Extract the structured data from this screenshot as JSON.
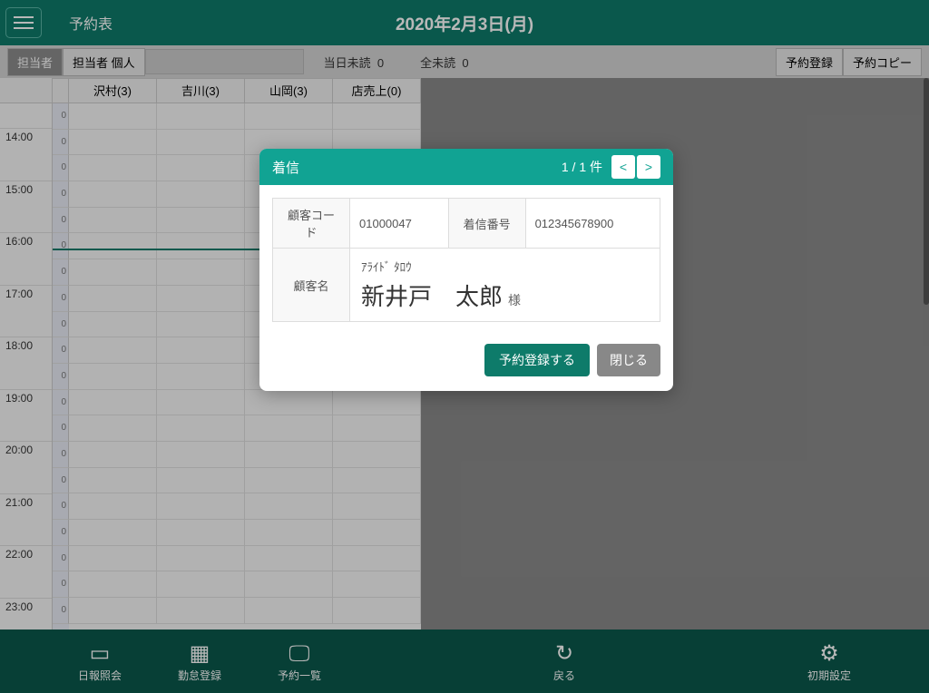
{
  "header": {
    "title": "予約表",
    "date": "2020年2月3日(月)"
  },
  "toolbar": {
    "staff_tab": "担当者",
    "staff_personal_tab": "担当者 個人",
    "today_unread": "当日未読",
    "today_unread_count": "0",
    "all_unread": "全未読",
    "all_unread_count": "0",
    "reserve_register": "予約登録",
    "reserve_copy": "予約コピー"
  },
  "schedule": {
    "staff": [
      "沢村(3)",
      "吉川(3)",
      "山岡(3)",
      "店売上(0)"
    ],
    "hours": [
      "14:00",
      "15:00",
      "16:00",
      "17:00",
      "18:00",
      "19:00",
      "20:00",
      "21:00",
      "22:00",
      "23:00"
    ]
  },
  "modal": {
    "title": "着信",
    "pager": "1 / 1 件",
    "prev": "<",
    "next": ">",
    "customer_code_label": "顧客コード",
    "customer_code": "01000047",
    "caller_label": "着信番号",
    "caller_number": "012345678900",
    "customer_name_label": "顧客名",
    "customer_kana": "ｱﾗｲﾄﾞ ﾀﾛｳ",
    "customer_name": "新井戸　太郎",
    "suffix": "様",
    "register_btn": "予約登録する",
    "close_btn": "閉じる"
  },
  "nav": {
    "report": "日報照会",
    "attendance": "勤怠登録",
    "reservation_list": "予約一覧",
    "back": "戻る",
    "settings": "初期設定"
  }
}
